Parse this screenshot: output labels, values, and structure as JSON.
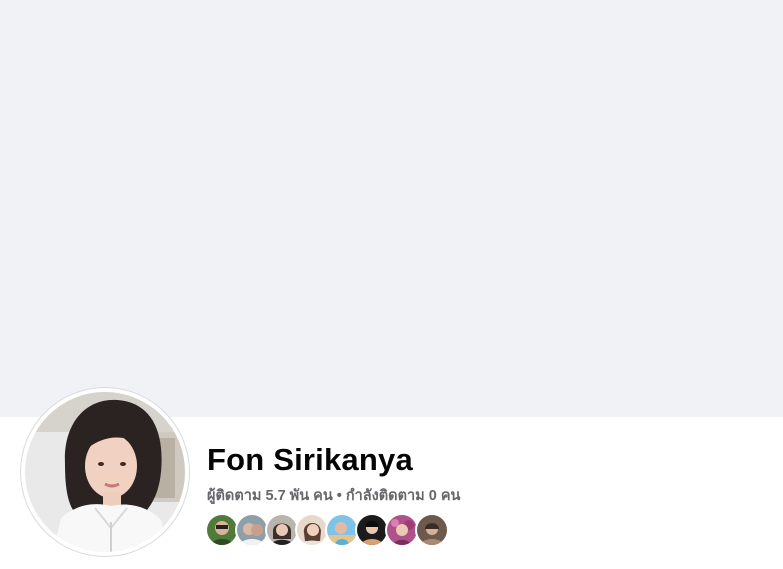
{
  "profile": {
    "name": "Fon Sirikanya",
    "followers_text": "ผู้ติดตาม 5.7 พัน คน",
    "separator": "•",
    "following_text": "กำลังติดตาม 0 คน"
  },
  "friend_avatars": [
    {
      "name": "friend-avatar-1"
    },
    {
      "name": "friend-avatar-2"
    },
    {
      "name": "friend-avatar-3"
    },
    {
      "name": "friend-avatar-4"
    },
    {
      "name": "friend-avatar-5"
    },
    {
      "name": "friend-avatar-6"
    },
    {
      "name": "friend-avatar-7"
    },
    {
      "name": "friend-avatar-8"
    }
  ],
  "colors": {
    "cover": "#f0f2f5",
    "name": "#050505",
    "secondary_text": "#65676b"
  }
}
